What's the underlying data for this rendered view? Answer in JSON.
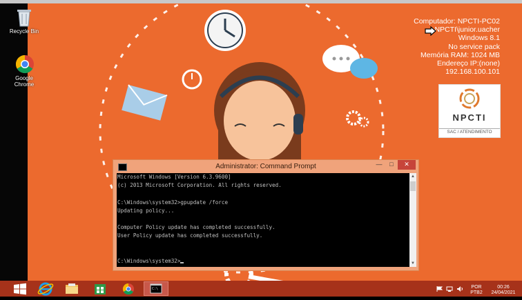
{
  "desktop": {
    "icons": [
      {
        "label": "Recycle Bin",
        "icon": "recycle-bin-icon"
      },
      {
        "label": "Google Chrome",
        "label_line1": "Google",
        "label_line2": "Chrome",
        "icon": "chrome-icon"
      }
    ]
  },
  "sysinfo": {
    "lines": [
      "Computador: NPCTI-PC02",
      "NPCTI\\junior.uacher",
      "Windows 8.1",
      "No service pack",
      "Memória RAM: 1024 MB",
      "Endereço IP:(none)",
      "192.168.100.101"
    ]
  },
  "logo": {
    "name": "NPCTI",
    "subtitle": "SAC / ATENDIMENTO"
  },
  "cmd_window": {
    "title": "Administrator: Command Prompt",
    "buttons": {
      "minimize": "—",
      "maximize": "□",
      "close": "✕"
    },
    "lines": [
      "Microsoft Windows [Version 6.3.9600]",
      "(c) 2013 Microsoft Corporation. All rights reserved.",
      "",
      "C:\\Windows\\system32>gpupdate /force",
      "Updating policy...",
      "",
      "Computer Policy update has completed successfully.",
      "User Policy update has completed successfully.",
      "",
      "",
      "C:\\Windows\\system32>"
    ]
  },
  "taskbar": {
    "items": [
      "start-button",
      "internet-explorer",
      "file-explorer",
      "windows-store",
      "google-chrome",
      "command-prompt"
    ],
    "tray": {
      "language_line1": "POR",
      "language_line2": "PTB2",
      "time": "00:26",
      "date": "24/04/2021"
    }
  },
  "colors": {
    "wallpaper": "#ec6a2e",
    "taskbar": "#a6321a",
    "cmd_frame": "#f0a37b",
    "cmd_text": "#c0c0c0"
  }
}
